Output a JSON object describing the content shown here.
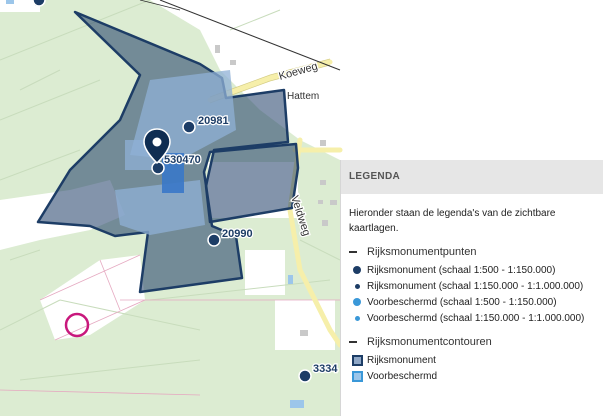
{
  "map": {
    "road_labels": [
      "Koeweg",
      "Hattem",
      "Veldweg"
    ],
    "monument_labels": [
      "20981",
      "530470",
      "20990",
      "3334"
    ],
    "colors": {
      "land": "#dcecd2",
      "open_field": "#ffffff",
      "monument_fill": "#1d3d66",
      "monument_stroke": "#1d3d66",
      "protected_fill": "#7ab3e0",
      "water": "#9cc6ea",
      "road": "#f6efaa",
      "marker": "#0f2d52",
      "highlight_circle": "#c8187c"
    },
    "icons": [
      "location-pin-icon",
      "highlight-circle-icon"
    ]
  },
  "legend": {
    "title": "LEGENDA",
    "intro": "Hieronder staan de legenda's van de zichtbare kaartlagen.",
    "sections": [
      {
        "title": "Rijksmonumentpunten",
        "items": [
          {
            "label": "Rijksmonument (schaal 1:500 - 1:150.000)",
            "symbol": "dot-large",
            "color": "#1d3d66"
          },
          {
            "label": "Rijksmonument (schaal 1:150.000 - 1:1.000.000)",
            "symbol": "dot-small",
            "color": "#1d3d66"
          },
          {
            "label": "Voorbeschermd (schaal 1:500 - 1:150.000)",
            "symbol": "dot-large",
            "color": "#3a98d8"
          },
          {
            "label": "Voorbeschermd (schaal 1:150.000 - 1:1.000.000)",
            "symbol": "dot-small",
            "color": "#3a98d8"
          }
        ]
      },
      {
        "title": "Rijksmonumentcontouren",
        "items": [
          {
            "label": "Rijksmonument",
            "symbol": "square-outline",
            "color": "#1d3d66"
          },
          {
            "label": "Voorbeschermd",
            "symbol": "square-dashed",
            "color": "#3a98d8"
          }
        ]
      }
    ]
  }
}
